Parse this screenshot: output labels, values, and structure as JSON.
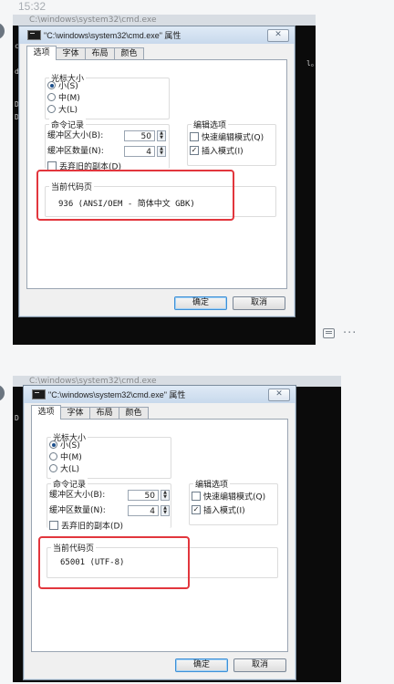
{
  "timestamp": "15:32",
  "console": {
    "left_fragments": [
      "c",
      "d",
      "D",
      "D",
      "y"
    ],
    "right_fragment": "l。",
    "title_ghost": "C:\\windows\\system32\\cmd.exe"
  },
  "messages": [
    {
      "dialog": {
        "title": "\"C:\\windows\\system32\\cmd.exe\" 属性",
        "close": "✕",
        "tabs": [
          "选项",
          "字体",
          "布局",
          "颜色"
        ],
        "cursor_size": {
          "label": "光标大小",
          "options": [
            "小(S)",
            "中(M)",
            "大(L)"
          ],
          "selected": 0
        },
        "history": {
          "label": "命令记录",
          "buffer_size_label": "缓冲区大小(B):",
          "buffer_size_value": "50",
          "buffer_count_label": "缓冲区数量(N):",
          "buffer_count_value": "4",
          "discard_old_label": "丢弃旧的副本(D)"
        },
        "edit_options": {
          "label": "编辑选项",
          "quick_edit_label": "快速编辑模式(Q)",
          "quick_edit_checked": false,
          "insert_mode_label": "插入模式(I)",
          "insert_mode_checked": true
        },
        "codepage": {
          "label": "当前代码页",
          "value": "936   (ANSI/OEM - 简体中文 GBK)"
        },
        "ok_label": "确定",
        "cancel_label": "取消"
      }
    },
    {
      "dialog": {
        "title": "\"C:\\windows\\system32\\cmd.exe\" 属性",
        "close": "✕",
        "tabs": [
          "选项",
          "字体",
          "布局",
          "颜色"
        ],
        "cursor_size": {
          "label": "光标大小",
          "options": [
            "小(S)",
            "中(M)",
            "大(L)"
          ],
          "selected": 0
        },
        "history": {
          "label": "命令记录",
          "buffer_size_label": "缓冲区大小(B):",
          "buffer_size_value": "50",
          "buffer_count_label": "缓冲区数量(N):",
          "buffer_count_value": "4",
          "discard_old_label": "丢弃旧的副本(D)"
        },
        "edit_options": {
          "label": "编辑选项",
          "quick_edit_label": "快速编辑模式(Q)",
          "quick_edit_checked": false,
          "insert_mode_label": "插入模式(I)",
          "insert_mode_checked": true
        },
        "codepage": {
          "label": "当前代码页",
          "value": "65001 (UTF-8)"
        },
        "ok_label": "确定",
        "cancel_label": "取消"
      }
    }
  ],
  "actions": {
    "comment_icon": "comment-icon",
    "more": "···"
  },
  "colors": {
    "highlight": "#e2363d",
    "console_bg": "#0b0b0b",
    "dialog_bg": "#f0f0f0"
  }
}
